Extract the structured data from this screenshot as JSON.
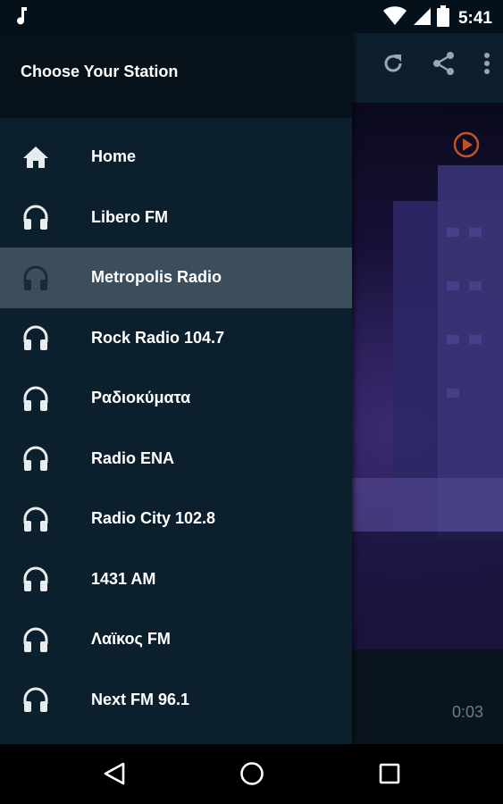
{
  "status_bar": {
    "time": "5:41",
    "icons": [
      "music-note-icon",
      "wifi-icon",
      "signal-icon",
      "battery-icon"
    ]
  },
  "drawer": {
    "title": "Choose Your Station",
    "items": [
      {
        "label": "Home",
        "icon": "home-icon",
        "active": false
      },
      {
        "label": "Libero FM",
        "icon": "headphones-icon",
        "active": false
      },
      {
        "label": "Metropolis Radio",
        "icon": "headphones-icon",
        "active": true
      },
      {
        "label": "Rock Radio 104.7",
        "icon": "headphones-icon",
        "active": false
      },
      {
        "label": "Ραδιοκύματα",
        "icon": "headphones-icon",
        "active": false
      },
      {
        "label": "Radio ENA",
        "icon": "headphones-icon",
        "active": false
      },
      {
        "label": "Radio City 102.8",
        "icon": "headphones-icon",
        "active": false
      },
      {
        "label": "1431 AM",
        "icon": "headphones-icon",
        "active": false
      },
      {
        "label": "Λαϊκος FM",
        "icon": "headphones-icon",
        "active": false
      },
      {
        "label": "Next FM 96.1",
        "icon": "headphones-icon",
        "active": false
      }
    ]
  },
  "app": {
    "actions": [
      "refresh-icon",
      "share-icon",
      "more-vert-icon"
    ],
    "player": {
      "elapsed": "0:03",
      "play_icon": "play-circle-icon",
      "accent_color": "#c0522a"
    }
  },
  "nav_bar": {
    "buttons": [
      "back-icon",
      "home-circle-icon",
      "recents-icon"
    ]
  },
  "colors": {
    "drawer_bg": "#0c1f2c",
    "drawer_header_bg": "#061119",
    "active_item_bg": "#3c4e5b",
    "text": "#ffffff"
  }
}
